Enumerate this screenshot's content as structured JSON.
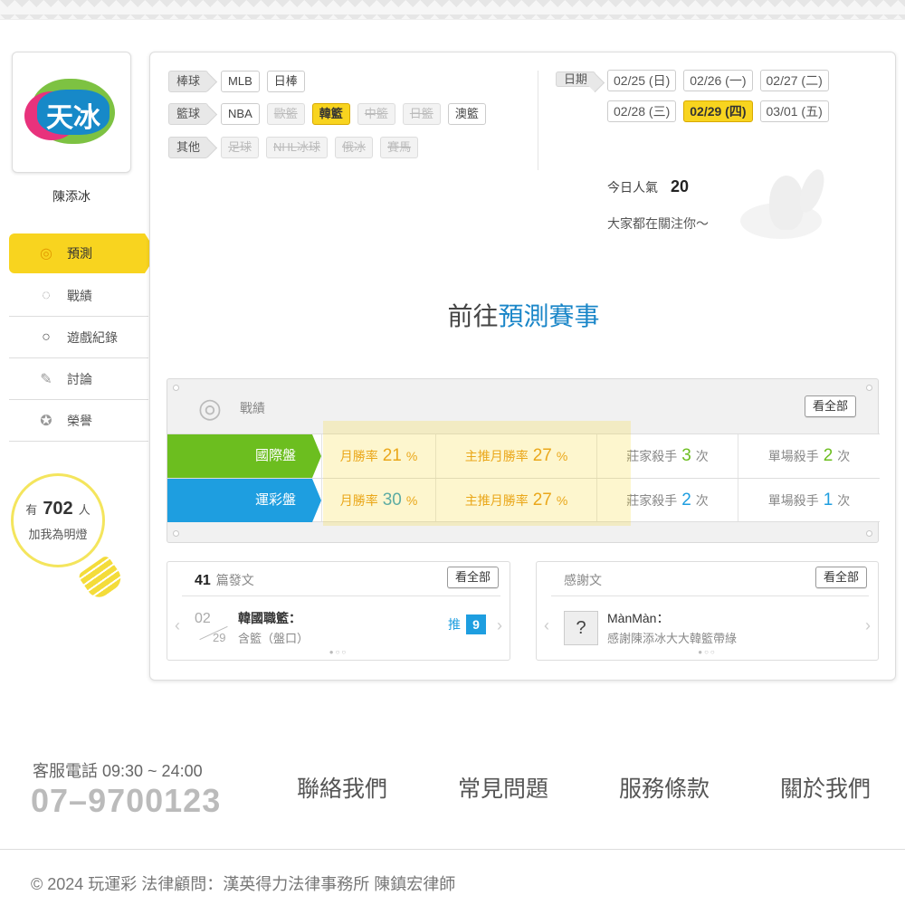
{
  "profile": {
    "logo_text": "天冰",
    "name": "陳添冰"
  },
  "nav": [
    {
      "label": "預測",
      "icon": "target-icon",
      "active": true
    },
    {
      "label": "戰績",
      "icon": "target-outline-icon",
      "active": false
    },
    {
      "label": "遊戲紀錄",
      "icon": "circle-icon",
      "active": false
    },
    {
      "label": "討論",
      "icon": "pencil-icon",
      "active": false
    },
    {
      "label": "榮譽",
      "icon": "medal-icon",
      "active": false
    }
  ],
  "fans": {
    "prefix": "有",
    "count": "702",
    "suffix": "人",
    "caption": "加我為明燈"
  },
  "categories": {
    "baseball": {
      "label": "棒球",
      "tags": [
        "MLB",
        "日棒"
      ]
    },
    "basketball": {
      "label": "籃球",
      "tags": [
        "NBA",
        "歐籃",
        "韓籃",
        "中籃",
        "日籃",
        "澳籃"
      ]
    },
    "other": {
      "label": "其他",
      "tags": [
        "足球",
        "NHL冰球",
        "俄冰",
        "賽馬"
      ]
    }
  },
  "dates": {
    "label": "日期",
    "items": [
      "02/25 (日)",
      "02/26 (一)",
      "02/27 (二)",
      "02/28 (三)",
      "02/29 (四)",
      "03/01 (五)"
    ],
    "selected": "02/29 (四)"
  },
  "popularity": {
    "label": "今日人氣",
    "count": "20",
    "caption": "大家都在關注你～"
  },
  "goto": {
    "prefix": "前往",
    "highlight": "預測賽事"
  },
  "record": {
    "title": "戰績",
    "view_all": "看全部",
    "rows": [
      {
        "type": "國際盤",
        "color": "#6cbe1f",
        "monthly_label": "月勝率",
        "monthly_value": "21",
        "monthly_unit": "%",
        "main_label": "主推月勝率",
        "main_value": "27",
        "main_unit": "%",
        "banker_label": "莊家殺手",
        "banker_value": "3",
        "banker_unit": "次",
        "single_label": "單場殺手",
        "single_value": "2",
        "single_unit": "次"
      },
      {
        "type": "運彩盤",
        "color": "#1e9ee0",
        "monthly_label": "月勝率",
        "monthly_value": "30",
        "monthly_unit": "%",
        "main_label": "主推月勝率",
        "main_value": "27",
        "main_unit": "%",
        "banker_label": "莊家殺手",
        "banker_value": "2",
        "banker_unit": "次",
        "single_label": "單場殺手",
        "single_value": "1",
        "single_unit": "次"
      }
    ]
  },
  "posts": {
    "count": "41",
    "label": "篇發文",
    "view_all": "看全部",
    "item": {
      "month": "02",
      "day": "29",
      "title": "韓國職籃：",
      "subtitle": "含籃（盤口）",
      "push_label": "推",
      "push_count": "9"
    },
    "pager": "●○○"
  },
  "thanks": {
    "title": "感謝文",
    "view_all": "看全部",
    "item": {
      "name": "MànMàn：",
      "message": "感謝陳添冰大大韓籃帶綠"
    },
    "pager": "●○○"
  },
  "footer": {
    "service_label": "客服電話 09:30 ~ 24:00",
    "phone": "07–9700123",
    "links": [
      "聯絡我們",
      "常見問題",
      "服務條款",
      "關於我們"
    ],
    "copyright": "© 2024 玩運彩 法律顧問：漢英得力法律事務所 陳鎮宏律師"
  },
  "colors": {
    "accent_yellow": "#f8d41f",
    "green": "#6cbe1f",
    "blue": "#1e9ee0",
    "orange": "#e79a18"
  }
}
